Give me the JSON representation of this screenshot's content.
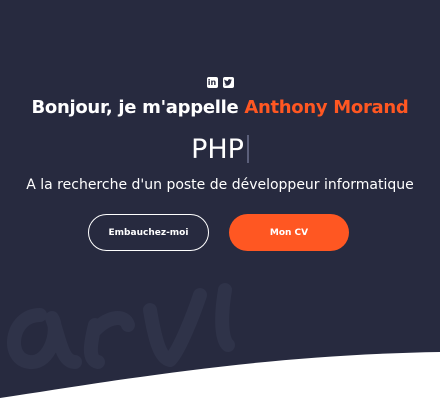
{
  "social": {
    "linkedin_icon": "linkedin-icon",
    "twitter_icon": "twitter-icon"
  },
  "hero": {
    "greeting": "Bonjour, je m'appelle",
    "name": "Anthony Morand",
    "typed_text": "PHP",
    "subtitle": "A la recherche d'un poste de développeur informatique"
  },
  "buttons": {
    "hire_label": "Embauchez-moi",
    "cv_label": "Mon CV"
  },
  "colors": {
    "background": "#272a3f",
    "accent": "#ff5722",
    "text": "#ffffff",
    "wave": "#ffffff"
  }
}
